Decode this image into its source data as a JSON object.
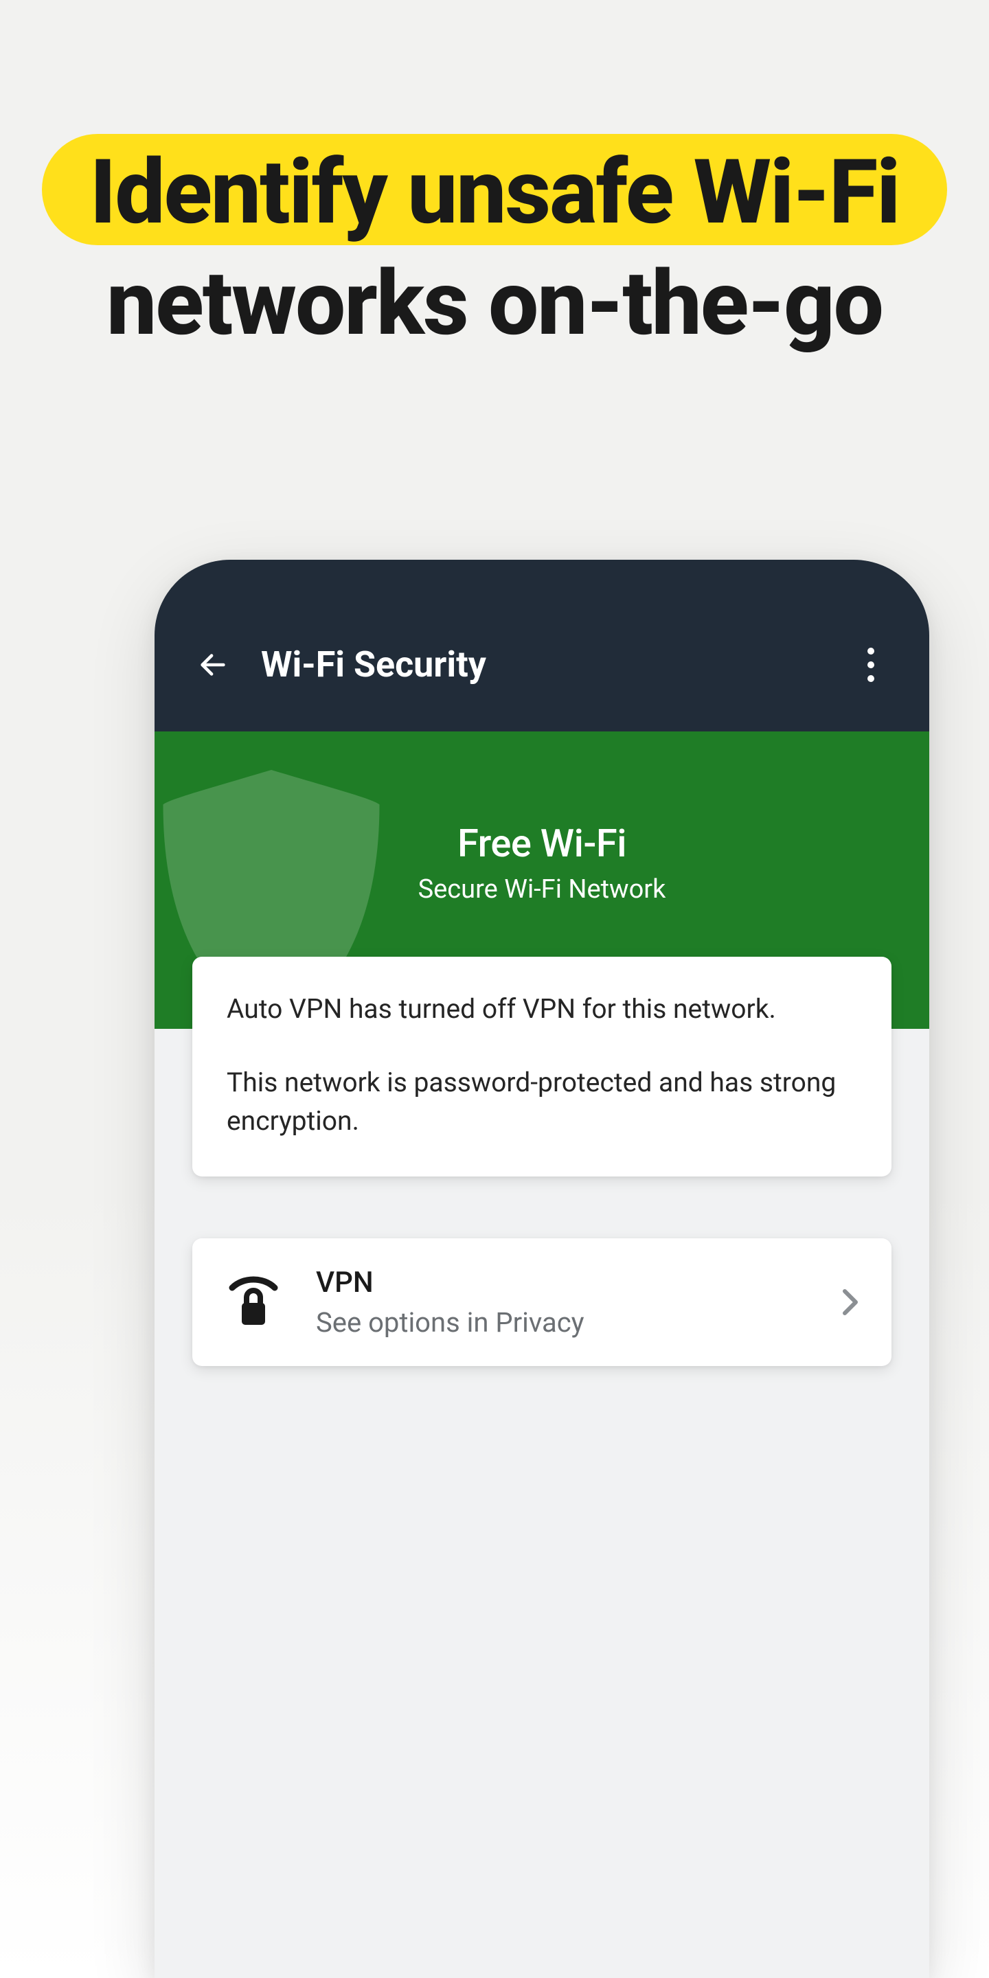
{
  "marketing": {
    "headline_line1": "Identify unsafe Wi-Fi",
    "headline_line2": "networks on-the-go"
  },
  "appbar": {
    "title": "Wi-Fi Security"
  },
  "hero": {
    "network_name": "Free Wi-Fi",
    "status": "Secure Wi-Fi Network"
  },
  "info_card": {
    "line1": "Auto VPN has turned off VPN for this network.",
    "line2": "This network is password-protected and has strong encryption."
  },
  "vpn_card": {
    "title": "VPN",
    "subtitle": "See options in Privacy"
  },
  "colors": {
    "highlight": "#ffe01b",
    "appbar_bg": "#212c39",
    "hero_bg": "#1f7d26"
  }
}
